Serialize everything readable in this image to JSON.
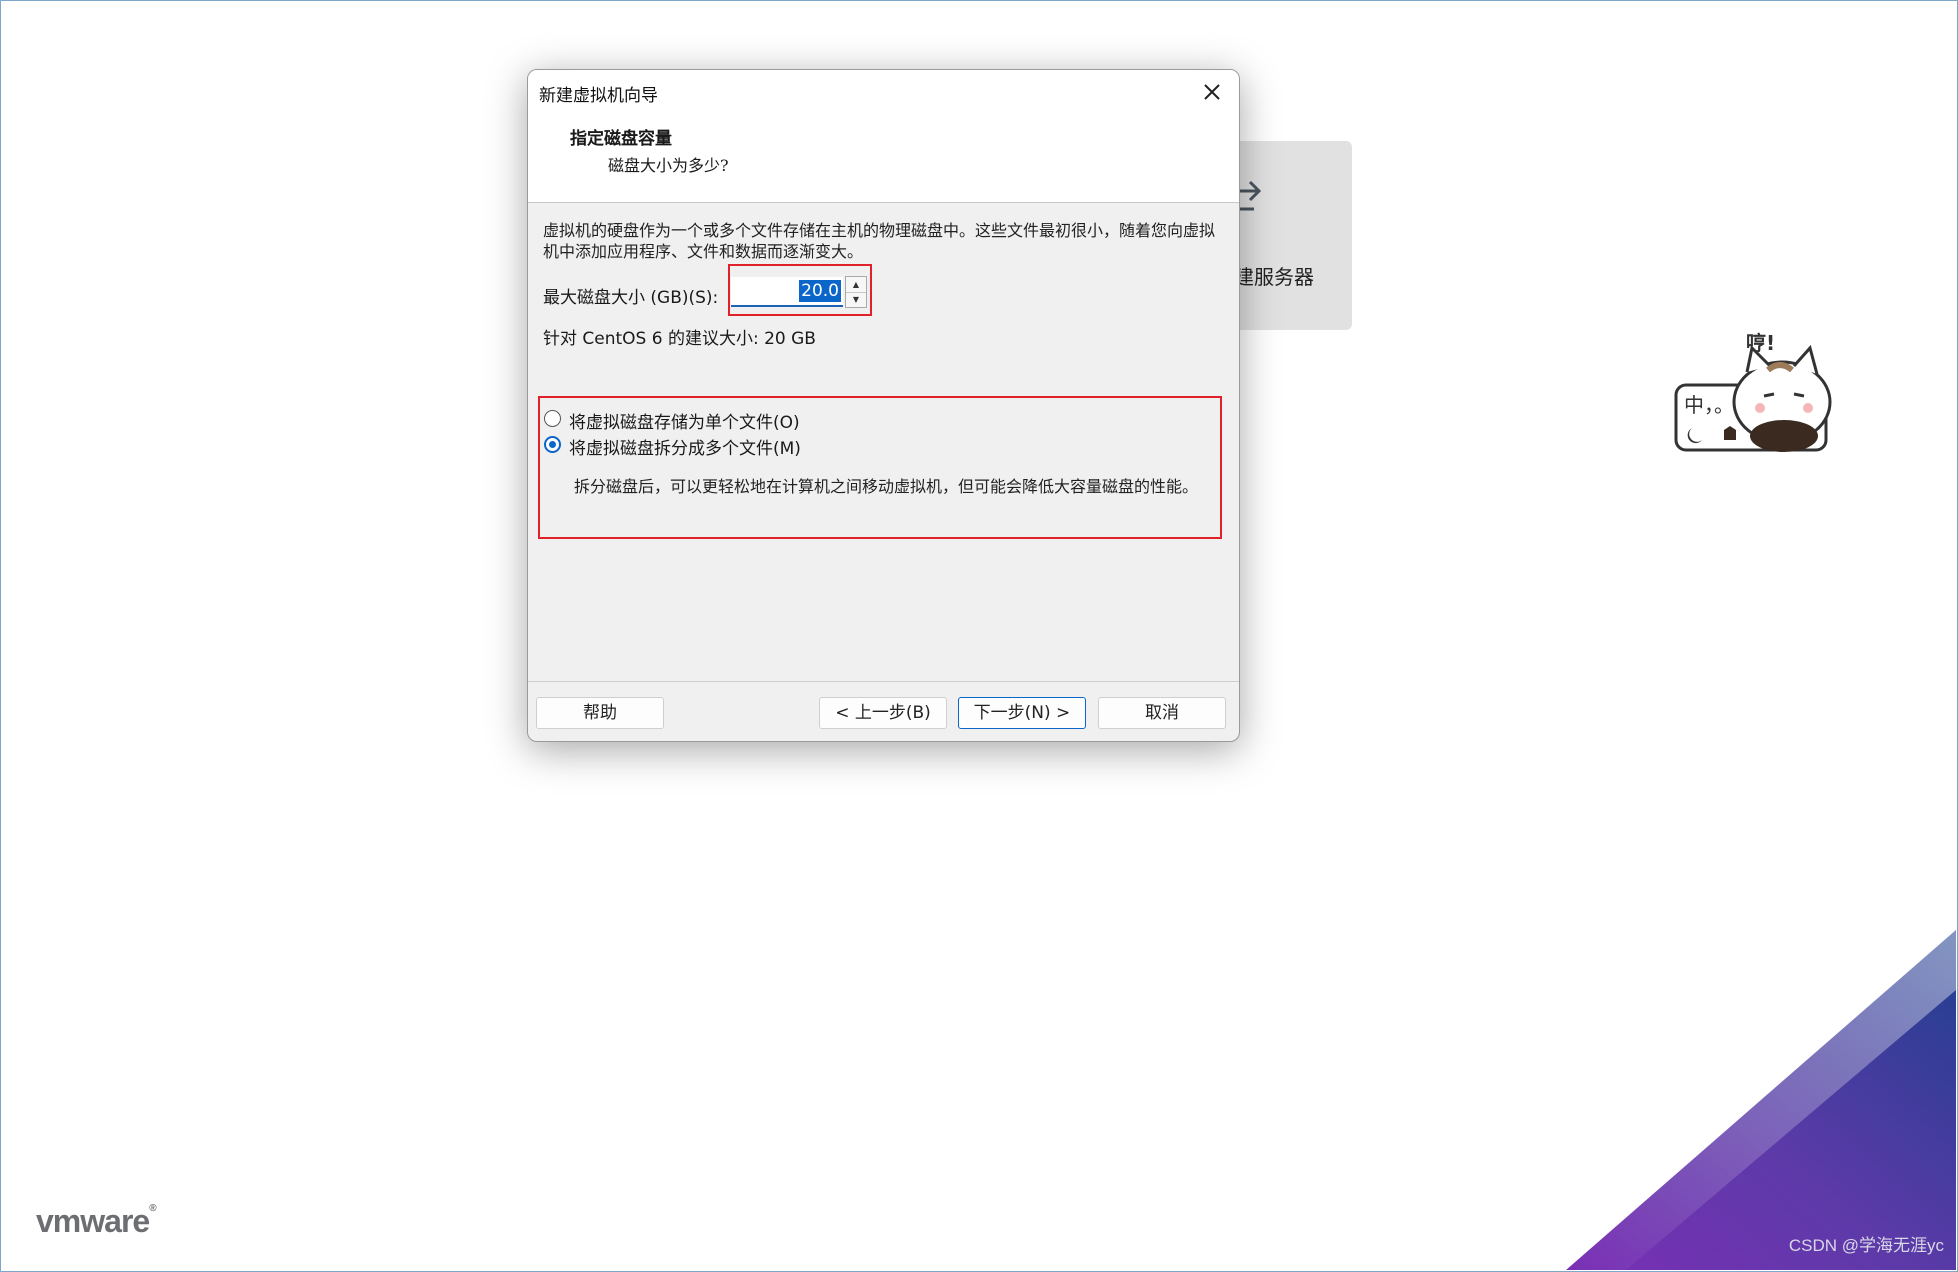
{
  "background": {
    "card_label": "建服务器",
    "sticker_text_bubble": "中，。",
    "sticker_exclaim": "哼!",
    "logo": "vmware",
    "watermark": "CSDN @学海无涯yc"
  },
  "dialog": {
    "title": "新建虚拟机向导",
    "header_title": "指定磁盘容量",
    "header_subtitle": "磁盘大小为多少?",
    "description": "虚拟机的硬盘作为一个或多个文件存储在主机的物理磁盘中。这些文件最初很小，随着您向虚拟机中添加应用程序、文件和数据而逐渐变大。",
    "max_size_label": "最大磁盘大小 (GB)(S):",
    "max_size_value": "20.0",
    "recommended": "针对 CentOS 6 的建议大小: 20 GB",
    "options": [
      {
        "label": "将虚拟磁盘存储为单个文件(O)",
        "selected": false
      },
      {
        "label": "将虚拟磁盘拆分成多个文件(M)",
        "selected": true
      }
    ],
    "split_description": "拆分磁盘后，可以更轻松地在计算机之间移动虚拟机，但可能会降低大容量磁盘的性能。",
    "buttons": {
      "help": "帮助",
      "back": "< 上一步(B)",
      "next": "下一步(N) >",
      "cancel": "取消"
    }
  },
  "colors": {
    "accent": "#0b66c9",
    "highlight_box": "#e0202a"
  }
}
